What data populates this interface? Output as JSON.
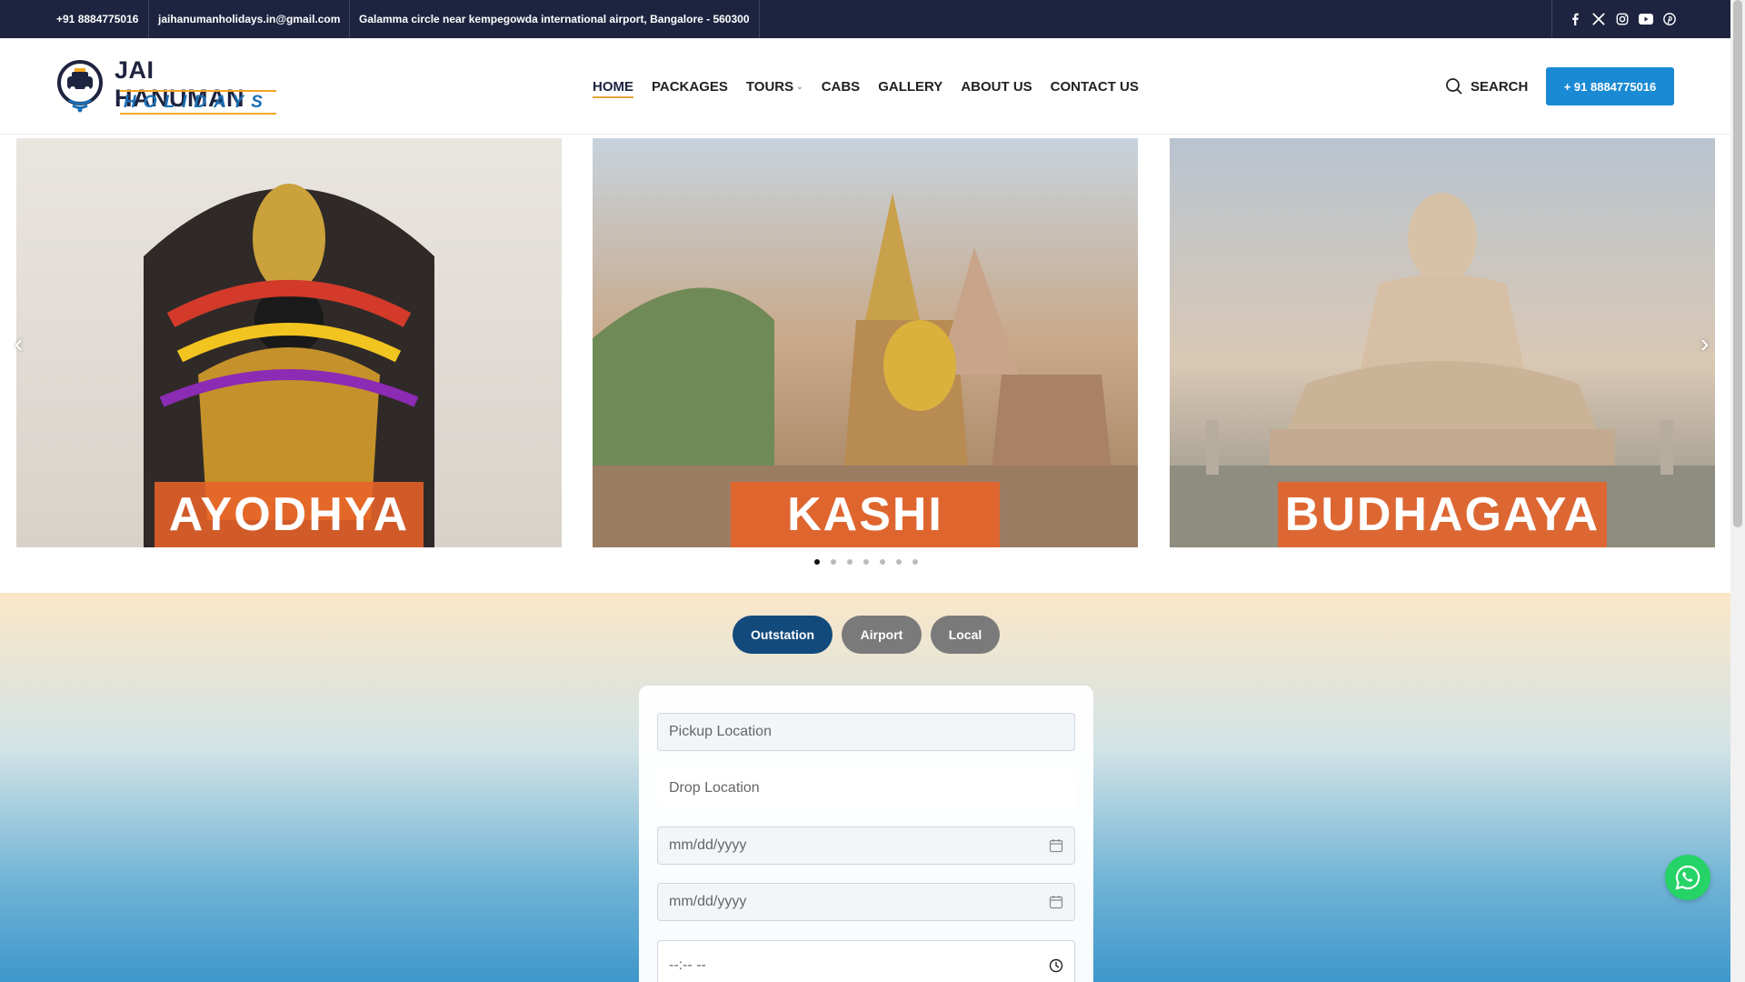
{
  "topbar": {
    "phone": "+91 8884775016",
    "email": "jaihanumanholidays.in@gmail.com",
    "address": "Galamma circle near kempegowda international airport, Bangalore - 560300",
    "socials": [
      "facebook-icon",
      "x-icon",
      "instagram-icon",
      "youtube-icon",
      "pinterest-icon"
    ]
  },
  "logo": {
    "line1": "JAI HANUMAN",
    "line2": "HOLIDAYS"
  },
  "nav": {
    "items": [
      "HOME",
      "PACKAGES",
      "TOURS",
      "CABS",
      "GALLERY",
      "ABOUT US",
      "CONTACT US"
    ],
    "active": "HOME"
  },
  "header": {
    "search_label": "SEARCH",
    "call_button": "+ 91 8884775016"
  },
  "slider": {
    "slides": [
      {
        "label": "AYODHYA"
      },
      {
        "label": "KASHI"
      },
      {
        "label": "BUDHAGAYA"
      }
    ],
    "dot_count": 7,
    "active_dot": 1
  },
  "booking": {
    "tabs": [
      "Outstation",
      "Airport",
      "Local"
    ],
    "active_tab": "Outstation",
    "pickup_placeholder": "Pickup Location",
    "drop_placeholder": "Drop Location",
    "date1_placeholder": "mm/dd/yyyy",
    "date2_placeholder": "mm/dd/yyyy",
    "time_placeholder": "--:-- --"
  },
  "colors": {
    "topbar": "#1e2440",
    "accent": "#1a8ad4",
    "label_orange": "#e86228",
    "tab_active": "#124a7c",
    "whatsapp": "#25d366"
  }
}
